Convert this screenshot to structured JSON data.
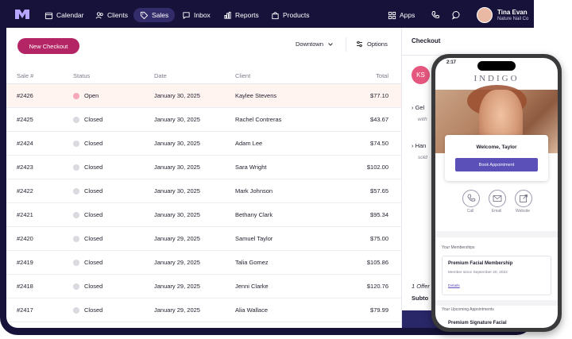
{
  "nav": {
    "items": [
      {
        "label": "Calendar",
        "icon": "calendar-icon"
      },
      {
        "label": "Clients",
        "icon": "users-icon"
      },
      {
        "label": "Sales",
        "icon": "tag-icon"
      },
      {
        "label": "Inbox",
        "icon": "chat-icon"
      },
      {
        "label": "Reports",
        "icon": "bar-chart-icon"
      },
      {
        "label": "Products",
        "icon": "bag-icon"
      }
    ],
    "apps_label": "Apps",
    "user_name": "Tina Evan",
    "user_business": "Nature Nail Co"
  },
  "sales": {
    "new_checkout_label": "New Checkout",
    "location": "Downtown",
    "options_label": "Options",
    "columns": [
      "Sale #",
      "Status",
      "Date",
      "Client",
      "Total"
    ],
    "rows": [
      {
        "sale": "#2426",
        "status": "Open",
        "date": "January 30, 2025",
        "client": "Kaylee Stevens",
        "total": "$77.10"
      },
      {
        "sale": "#2425",
        "status": "Closed",
        "date": "January 30, 2025",
        "client": "Rachel Contreras",
        "total": "$43.67"
      },
      {
        "sale": "#2424",
        "status": "Closed",
        "date": "January 30, 2025",
        "client": "Adam Lee",
        "total": "$74.50"
      },
      {
        "sale": "#2423",
        "status": "Closed",
        "date": "January 30, 2025",
        "client": "Sara Wright",
        "total": "$102.00"
      },
      {
        "sale": "#2422",
        "status": "Closed",
        "date": "January 30, 2025",
        "client": "Mark Johnson",
        "total": "$57.65"
      },
      {
        "sale": "#2421",
        "status": "Closed",
        "date": "January 30, 2025",
        "client": "Bethany Clark",
        "total": "$95.34"
      },
      {
        "sale": "#2420",
        "status": "Closed",
        "date": "January 29, 2025",
        "client": "Samuel Taylor",
        "total": "$75.00"
      },
      {
        "sale": "#2419",
        "status": "Closed",
        "date": "January 29, 2025",
        "client": "Talia Gomez",
        "total": "$105.86"
      },
      {
        "sale": "#2418",
        "status": "Closed",
        "date": "January 29, 2025",
        "client": "Jenni Clarke",
        "total": "$120.76"
      },
      {
        "sale": "#2417",
        "status": "Closed",
        "date": "January 29, 2025",
        "client": "Alia Wallace",
        "total": "$79.99"
      }
    ]
  },
  "checkout": {
    "title": "Checkout",
    "initials": "KS",
    "item1": "Gel",
    "item1_sub": "with",
    "item2": "Han",
    "item2_sub": "sold",
    "offer": "1 Offer",
    "subtotal": "Subto"
  },
  "phone": {
    "time": "2:17",
    "brand": "INDIGO",
    "welcome": "Welcome, Taylor",
    "book_label": "Book Appointment",
    "contacts": [
      {
        "label": "Call",
        "icon": "phone-icon"
      },
      {
        "label": "Email",
        "icon": "mail-icon"
      },
      {
        "label": "Website",
        "icon": "external-link-icon"
      }
    ],
    "memberships_label": "Your Memberships",
    "membership_title": "Premium Facial Membership",
    "membership_since": "Member since September 20, 2022",
    "details_label": "Details",
    "appointments_label": "Your Upcoming Appointments",
    "appointment_title": "Premium Signature Facial"
  },
  "colors": {
    "nav_bg": "#16123a",
    "accent": "#b32565",
    "open_dot": "#f6a9be",
    "book_button": "#5b4fb8"
  }
}
